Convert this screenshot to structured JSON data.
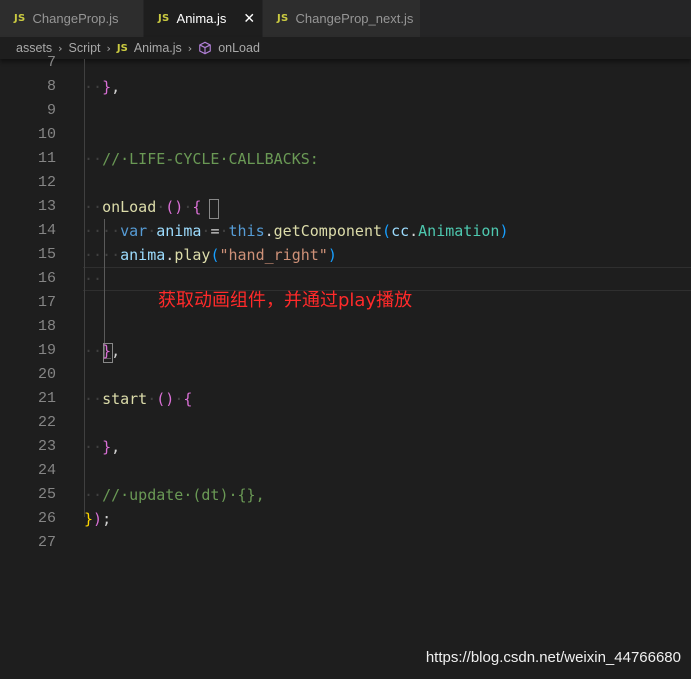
{
  "tabs": [
    {
      "badge": "JS",
      "label": "ChangeProp.js",
      "active": false
    },
    {
      "badge": "JS",
      "label": "Anima.js",
      "active": true,
      "close": "✕"
    },
    {
      "badge": "JS",
      "label": "ChangeProp_next.js",
      "active": false
    }
  ],
  "breadcrumb": {
    "items": [
      "assets",
      "Script",
      "Anima.js",
      "onLoad"
    ],
    "separator": "›",
    "file_badge": "JS"
  },
  "editor": {
    "line_numbers": [
      "7",
      "8",
      "9",
      "10",
      "11",
      "12",
      "13",
      "14",
      "15",
      "16",
      "17",
      "18",
      "19",
      "20",
      "21",
      "22",
      "23",
      "24",
      "25",
      "26",
      "27"
    ],
    "current_line": "16"
  },
  "annotation": {
    "text": "获取动画组件，并通过play播放",
    "color": "#ff2a2a"
  },
  "watermark": "https://blog.csdn.net/weixin_44766680",
  "colors": {
    "background": "#1e1e1e",
    "tabbar": "#252526",
    "comment": "#6a9955",
    "keyword": "#569cd6",
    "variable": "#9cdcfe",
    "function": "#dcdcaa",
    "string": "#ce9178",
    "js_badge": "#cbcb41"
  }
}
